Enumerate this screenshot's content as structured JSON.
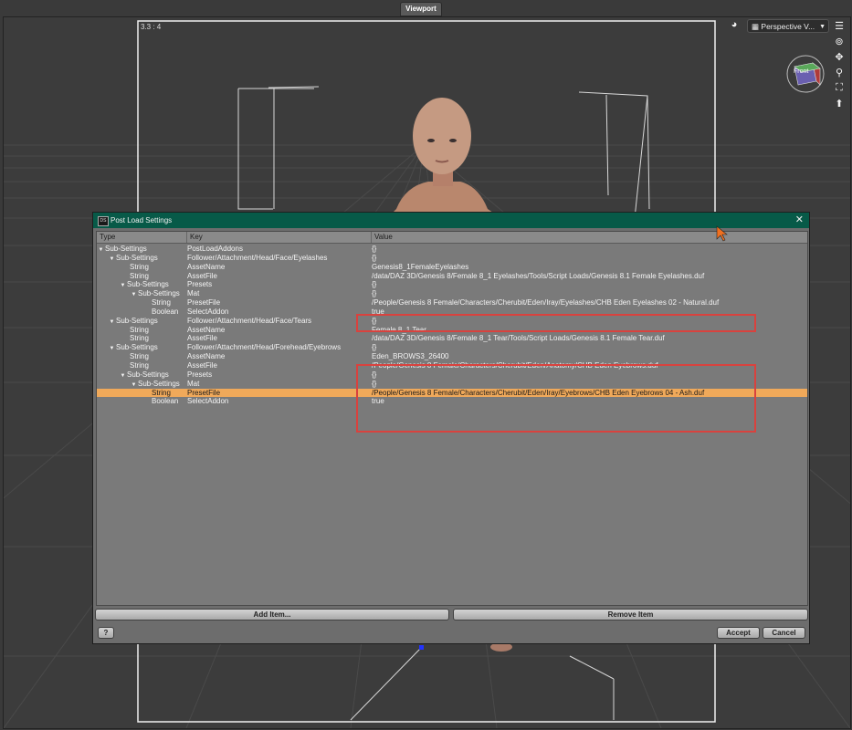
{
  "viewport": {
    "tab_label": "Viewport",
    "frame_ratio": "3.3 : 4",
    "view_select": "Perspective V...",
    "cube_label": "Front",
    "icons": [
      "render-icon",
      "viewport-menu-icon",
      "orbit-icon",
      "pan-icon",
      "zoom-icon",
      "frame-icon",
      "reset-icon"
    ]
  },
  "dialog": {
    "title": "Post Load Settings",
    "app_icon": "DS",
    "columns": [
      "Type",
      "Key",
      "Value"
    ],
    "rows": [
      {
        "indent": 0,
        "expand": true,
        "type": "Sub-Settings",
        "key": "PostLoadAddons",
        "value": "{}"
      },
      {
        "indent": 1,
        "expand": true,
        "type": "Sub-Settings",
        "key": "Follower/Attachment/Head/Face/Eyelashes",
        "value": "{}"
      },
      {
        "indent": 3,
        "expand": false,
        "type": "String",
        "key": "AssetName",
        "value": "Genesis8_1FemaleEyelashes"
      },
      {
        "indent": 3,
        "expand": false,
        "type": "String",
        "key": "AssetFile",
        "value": "/data/DAZ 3D/Genesis 8/Female 8_1 Eyelashes/Tools/Script Loads/Genesis 8.1 Female Eyelashes.duf"
      },
      {
        "indent": 2,
        "expand": true,
        "type": "Sub-Settings",
        "key": "Presets",
        "value": "{}"
      },
      {
        "indent": 3,
        "expand": true,
        "type": "Sub-Settings",
        "key": "Mat",
        "value": "{}"
      },
      {
        "indent": 5,
        "expand": false,
        "type": "String",
        "key": "PresetFile",
        "value": "/People/Genesis 8 Female/Characters/Cherubit/Eden/Iray/Eyelashes/CHB Eden Eyelashes 02 - Natural.duf"
      },
      {
        "indent": 5,
        "expand": false,
        "type": "Boolean",
        "key": "SelectAddon",
        "value": "true"
      },
      {
        "indent": 1,
        "expand": true,
        "type": "Sub-Settings",
        "key": "Follower/Attachment/Head/Face/Tears",
        "value": "{}"
      },
      {
        "indent": 3,
        "expand": false,
        "type": "String",
        "key": "AssetName",
        "value": "Female 8_1 Tear"
      },
      {
        "indent": 3,
        "expand": false,
        "type": "String",
        "key": "AssetFile",
        "value": "/data/DAZ 3D/Genesis 8/Female 8_1 Tear/Tools/Script Loads/Genesis 8.1 Female Tear.duf"
      },
      {
        "indent": 1,
        "expand": true,
        "type": "Sub-Settings",
        "key": "Follower/Attachment/Head/Forehead/Eyebrows",
        "value": "{}"
      },
      {
        "indent": 3,
        "expand": false,
        "type": "String",
        "key": "AssetName",
        "value": "Eden_BROWS3_26400"
      },
      {
        "indent": 3,
        "expand": false,
        "type": "String",
        "key": "AssetFile",
        "value": "/People/Genesis 8 Female/Characters/Cherubit/Eden/Anatomy/CHB Eden Eyebrows.duf"
      },
      {
        "indent": 2,
        "expand": true,
        "type": "Sub-Settings",
        "key": "Presets",
        "value": "{}"
      },
      {
        "indent": 3,
        "expand": true,
        "type": "Sub-Settings",
        "key": "Mat",
        "value": "{}"
      },
      {
        "indent": 5,
        "expand": false,
        "type": "String",
        "key": "PresetFile",
        "value": "/People/Genesis 8 Female/Characters/Cherubit/Eden/Iray/Eyebrows/CHB Eden Eyebrows 04 - Ash.duf",
        "selected": true
      },
      {
        "indent": 5,
        "expand": false,
        "type": "Boolean",
        "key": "SelectAddon",
        "value": "true"
      }
    ],
    "add_item": "Add Item...",
    "remove_item": "Remove Item",
    "help": "?",
    "accept": "Accept",
    "cancel": "Cancel",
    "highlight_color": "#d9423e",
    "selection_color": "#f0a95a",
    "titlebar_color": "#075a48"
  }
}
